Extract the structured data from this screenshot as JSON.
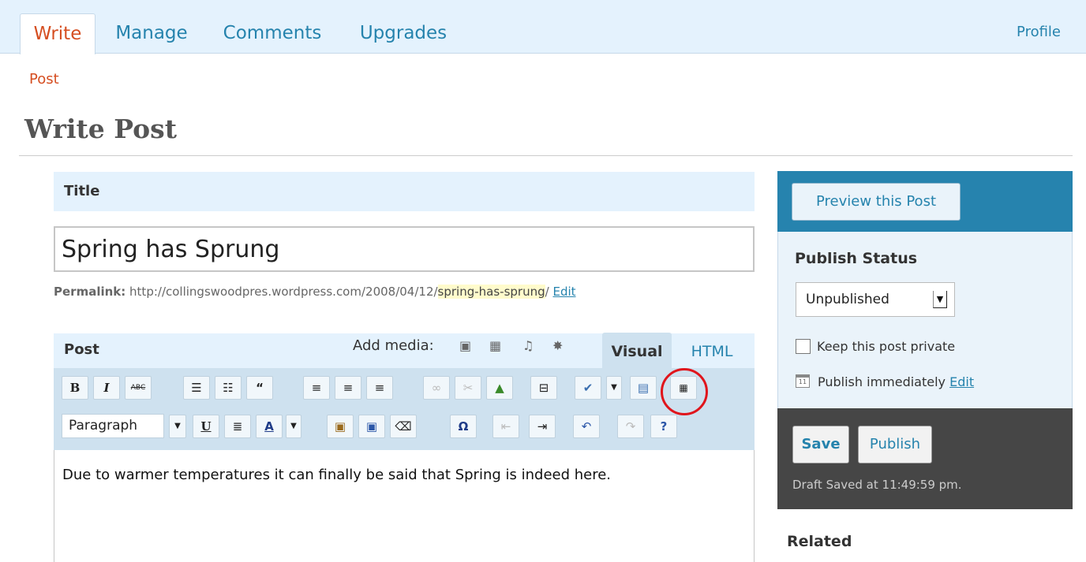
{
  "nav": {
    "tabs": [
      {
        "label": "Write"
      },
      {
        "label": "Manage"
      },
      {
        "label": "Comments"
      },
      {
        "label": "Upgrades"
      }
    ],
    "profile": "Profile",
    "subnav": "Post"
  },
  "page_title": "Write Post",
  "title_section": {
    "heading": "Title",
    "value": "Spring has Sprung",
    "permalink_label": "Permalink:",
    "permalink_base": "http://collingswoodpres.wordpress.com/2008/04/12/",
    "permalink_slug": "spring-has-sprung",
    "permalink_trail": "/",
    "permalink_edit": "Edit"
  },
  "post_section": {
    "heading": "Post",
    "add_media": "Add media:",
    "tab_visual": "Visual",
    "tab_html": "HTML",
    "format_select": "Paragraph",
    "content": "Due to warmer temperatures it can finally be said that Spring is indeed here."
  },
  "sidebar": {
    "preview_button": "Preview this Post",
    "publish_status_heading": "Publish Status",
    "status_value": "Unpublished",
    "private_label": "Keep this post private",
    "private_checked": false,
    "publish_time": "Publish immediately",
    "publish_edit": "Edit",
    "save_button": "Save",
    "publish_button": "Publish",
    "draft_saved": "Draft Saved at 11:49:59 pm.",
    "related_heading": "Related"
  }
}
